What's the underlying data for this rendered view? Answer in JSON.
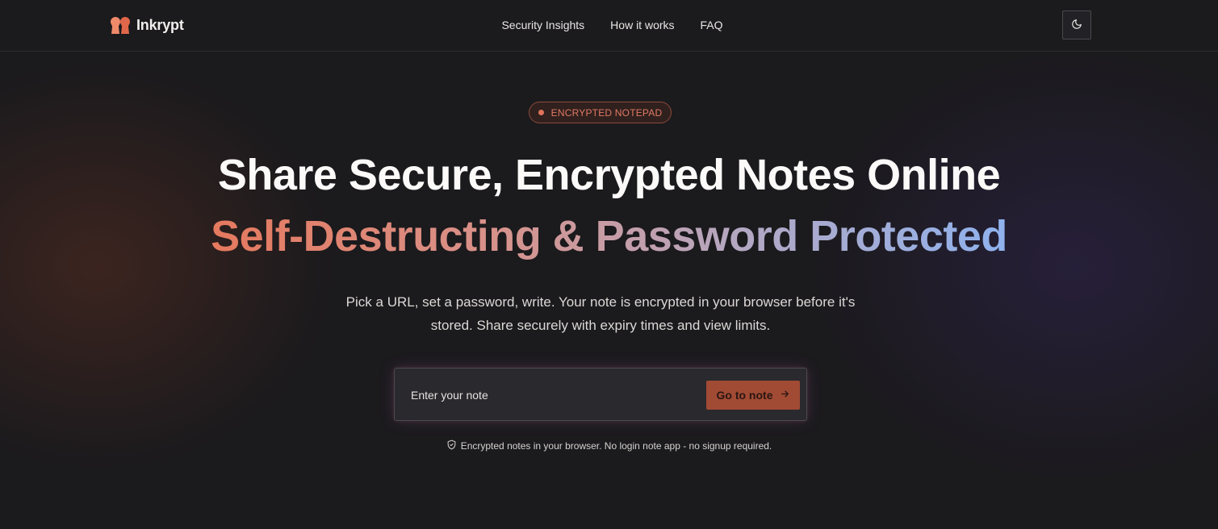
{
  "brand": {
    "name": "Inkrypt",
    "logo_icon": "keyhole-logo-icon",
    "accent": "#e5795e"
  },
  "nav": {
    "items": [
      {
        "label": "Security Insights"
      },
      {
        "label": "How it works"
      },
      {
        "label": "FAQ"
      }
    ]
  },
  "theme_toggle": {
    "icon": "moon-icon"
  },
  "hero": {
    "badge": "ENCRYPTED NOTEPAD",
    "title": "Share Secure, Encrypted Notes Online",
    "subtitle": "Self-Destructing & Password Protected",
    "lead": "Pick a URL, set a password, write. Your note is encrypted in your browser before it's stored. Share securely with expiry times and view limits.",
    "input_placeholder": "Enter your note",
    "input_value": "",
    "button_label": "Go to note",
    "button_icon": "arrow-right-icon",
    "footnote": "Encrypted notes in your browser. No login note app - no signup required.",
    "footnote_icon": "shield-check-icon"
  },
  "colors": {
    "background": "#1b1a1d",
    "button": "#a14a34",
    "badge_text": "#e07a63",
    "gradient_start": "#e5795e",
    "gradient_end": "#8fb2ee"
  }
}
